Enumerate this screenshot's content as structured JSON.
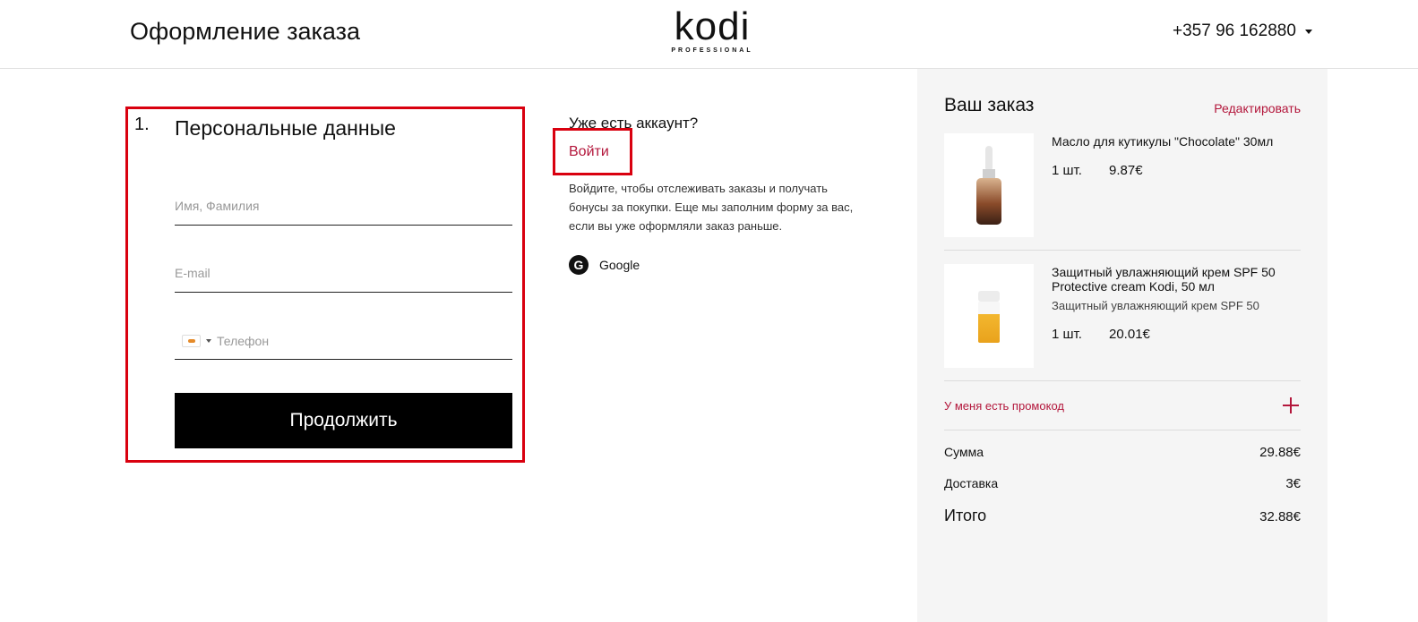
{
  "header": {
    "title": "Оформление заказа",
    "logo_main": "kodi",
    "logo_sub": "PROFESSIONAL",
    "phone": "+357 96 162880"
  },
  "personal": {
    "step": "1.",
    "heading": "Персональные данные",
    "name_placeholder": "Имя, Фамилия",
    "email_placeholder": "E-mail",
    "phone_placeholder": "Телефон",
    "continue_label": "Продолжить"
  },
  "account": {
    "question": "Уже есть аккаунт?",
    "login_label": "Войти",
    "hint": "Войдите, чтобы отслеживать заказы и получать бонусы за покупки. Еще мы заполним форму за вас, если вы уже оформляли заказ раньше.",
    "google_letter": "G",
    "google_label": "Google"
  },
  "order": {
    "title": "Ваш заказ",
    "edit_label": "Редактировать",
    "items": [
      {
        "name": "Масло для кутикулы \"Chocolate\" 30мл",
        "description": "",
        "qty": "1 шт.",
        "price": "9.87€",
        "image_icon": "cuticle-oil-bottle-icon"
      },
      {
        "name": "Защитный увлажняющий крем SPF 50 Protective cream Kodi, 50 мл",
        "description": "Защитный увлажняющий крем SPF 50",
        "qty": "1 шт.",
        "price": "20.01€",
        "image_icon": "cream-tube-icon"
      }
    ],
    "promo_label": "У меня есть промокод",
    "sum_label": "Сумма",
    "sum_value": "29.88€",
    "delivery_label": "Доставка",
    "delivery_value": "3€",
    "total_label": "Итого",
    "total_value": "32.88€"
  },
  "colors": {
    "accent": "#b3163b",
    "highlight_border": "#d9000f",
    "summary_bg": "#f5f5f5",
    "button_bg": "#000000"
  }
}
